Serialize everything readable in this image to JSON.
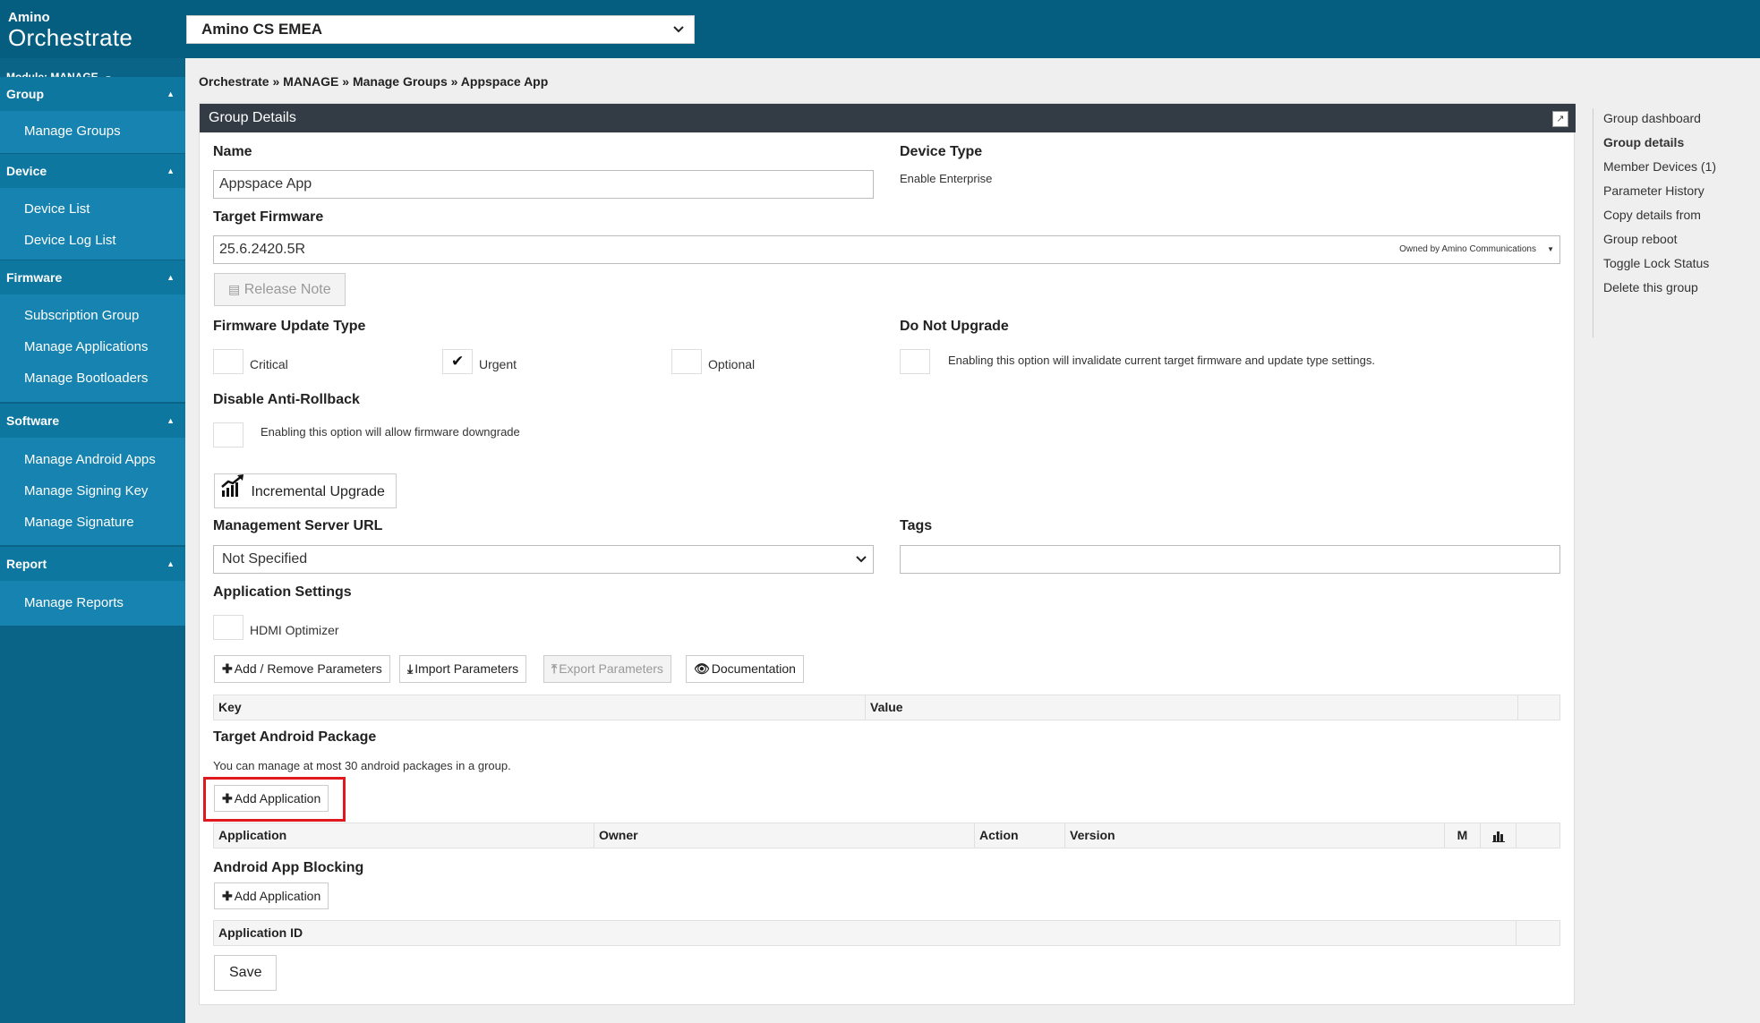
{
  "app": {
    "logo_small": "Amino",
    "logo_big": "Orchestrate",
    "org_selector": "Amino CS EMEA"
  },
  "sidebar": {
    "module": "Module: MANAGE",
    "sections": [
      {
        "title": "Group",
        "items": [
          "Manage Groups"
        ]
      },
      {
        "title": "Device",
        "items": [
          "Device List",
          "Device Log List"
        ]
      },
      {
        "title": "Firmware",
        "items": [
          "Subscription Group",
          "Manage Applications",
          "Manage Bootloaders"
        ]
      },
      {
        "title": "Software",
        "items": [
          "Manage Android Apps",
          "Manage Signing Key",
          "Manage Signature"
        ]
      },
      {
        "title": "Report",
        "items": [
          "Manage Reports"
        ]
      }
    ]
  },
  "breadcrumb": "Orchestrate » MANAGE » Manage Groups » Appspace App",
  "panel": {
    "title": "Group Details",
    "name_label": "Name",
    "name_value": "Appspace App",
    "device_type_label": "Device Type",
    "device_type_value": "Enable Enterprise",
    "target_firmware_label": "Target Firmware",
    "target_firmware_value": "25.6.2420.5R",
    "firmware_owner": "Owned by Amino Communications",
    "release_note_button": "Release Note",
    "fw_update_type_label": "Firmware Update Type",
    "fw_update_options": [
      {
        "label": "Critical",
        "checked": false
      },
      {
        "label": "Urgent",
        "checked": true
      },
      {
        "label": "Optional",
        "checked": false
      }
    ],
    "do_not_upgrade_label": "Do Not Upgrade",
    "do_not_upgrade_text": "Enabling this option will invalidate current target firmware and update type settings.",
    "anti_rollback_label": "Disable Anti-Rollback",
    "anti_rollback_text": "Enabling this option will allow firmware downgrade",
    "incremental_upgrade_button": "Incremental Upgrade",
    "mgmt_url_label": "Management Server URL",
    "mgmt_url_value": "Not Specified",
    "tags_label": "Tags",
    "tags_value": "",
    "app_settings_label": "Application Settings",
    "hdmi_optimizer_label": "HDMI Optimizer",
    "param_buttons": {
      "add_remove": "Add / Remove Parameters",
      "import": "Import Parameters",
      "export": "Export Parameters",
      "documentation": "Documentation"
    },
    "param_table_headers": [
      "Key",
      "Value"
    ],
    "target_android_label": "Target Android Package",
    "target_android_note": "You can manage at most 30 android packages in a group.",
    "add_application_button": "Add Application",
    "app_table_headers": [
      "Application",
      "Owner",
      "Action",
      "Version",
      "M"
    ],
    "app_blocking_label": "Android App Blocking",
    "add_application_button_2": "Add Application",
    "blocking_table_headers": [
      "Application ID"
    ],
    "save_button": "Save"
  },
  "right_nav": [
    {
      "label": "Group dashboard",
      "active": false
    },
    {
      "label": "Group details",
      "active": true
    },
    {
      "label": "Member Devices (1)",
      "active": false
    },
    {
      "label": "Parameter History",
      "active": false
    },
    {
      "label": "Copy details from",
      "active": false
    },
    {
      "label": "Group reboot",
      "active": false
    },
    {
      "label": "Toggle Lock Status",
      "active": false
    },
    {
      "label": "Delete this group",
      "active": false
    }
  ]
}
